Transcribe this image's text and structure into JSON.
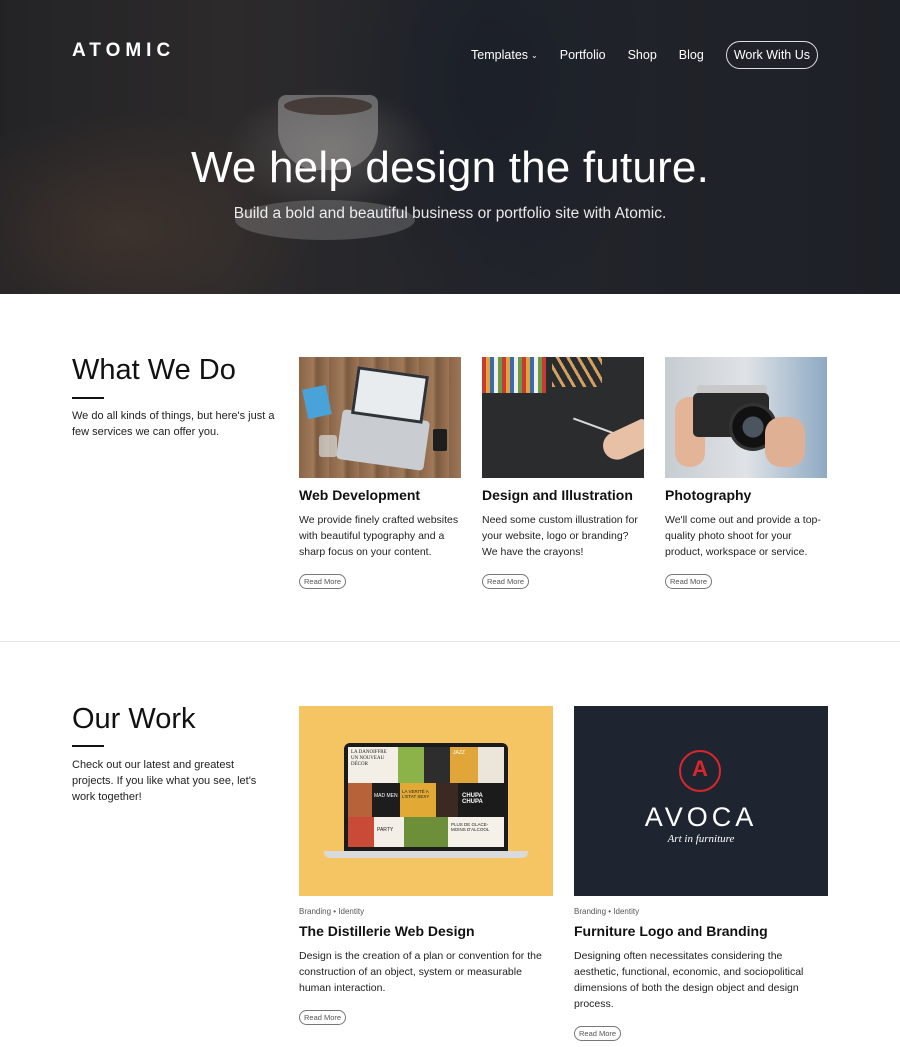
{
  "brand": {
    "logo": "ATOMIC"
  },
  "nav": {
    "items": [
      {
        "label": "Templates"
      },
      {
        "label": "Portfolio"
      },
      {
        "label": "Shop"
      },
      {
        "label": "Blog"
      }
    ],
    "dropdown_icon": "chevron-down-icon",
    "cta": "Work With Us"
  },
  "hero": {
    "title": "We help design the future.",
    "subtitle": "Build a bold and beautiful business or portfolio site with Atomic."
  },
  "what_we_do": {
    "title": "What We Do",
    "description": "We do all kinds of things, but here's just a few services we can offer you.",
    "services": [
      {
        "title": "Web Development",
        "text": "We provide finely crafted websites with beautiful typography and a sharp focus on your content.",
        "cta": "Read More"
      },
      {
        "title": "Design and Illustration",
        "text": "Need some custom illustration for your website, logo or branding? We have the crayons!",
        "cta": "Read More"
      },
      {
        "title": "Photography",
        "text": "We'll come out and provide a top-quality photo shoot for your product, workspace or service.",
        "cta": "Read More"
      }
    ]
  },
  "our_work": {
    "title": "Our Work",
    "description": "Check out our latest and greatest projects. If you like what you see, let's work together!",
    "projects": [
      {
        "tags": "Branding • Identity",
        "title": "The Distillerie Web Design",
        "text": "Design is the creation of a plan or convention for the construction of an object, system or measurable human interaction.",
        "cta": "Read More",
        "image_text": {
          "t1": "LA DANOIFFRE UN NOUVEAU DÉCOR",
          "t2": "JAZZ",
          "t3": "MAD MEN",
          "t4": "LA VERITÉ A L'ETAT SEXY",
          "t5": "CHUPA CHUPA",
          "t6": "PARTY",
          "t7": "PLUS DE GLACE-MOINS D'ALCOOL"
        }
      },
      {
        "tags": "Branding • Identity",
        "title": "Furniture Logo and Branding",
        "text": "Designing often necessitates considering the aesthetic, functional, economic, and sociopolitical dimensions of both the design object and design process.",
        "cta": "Read More",
        "image_text": {
          "logo_letter": "A",
          "name": "AVOCA",
          "tagline": "Art in furniture"
        }
      }
    ]
  },
  "colors": {
    "accent_red": "#d8262b",
    "navy": "#1f2530",
    "yellow": "#f5c563"
  }
}
